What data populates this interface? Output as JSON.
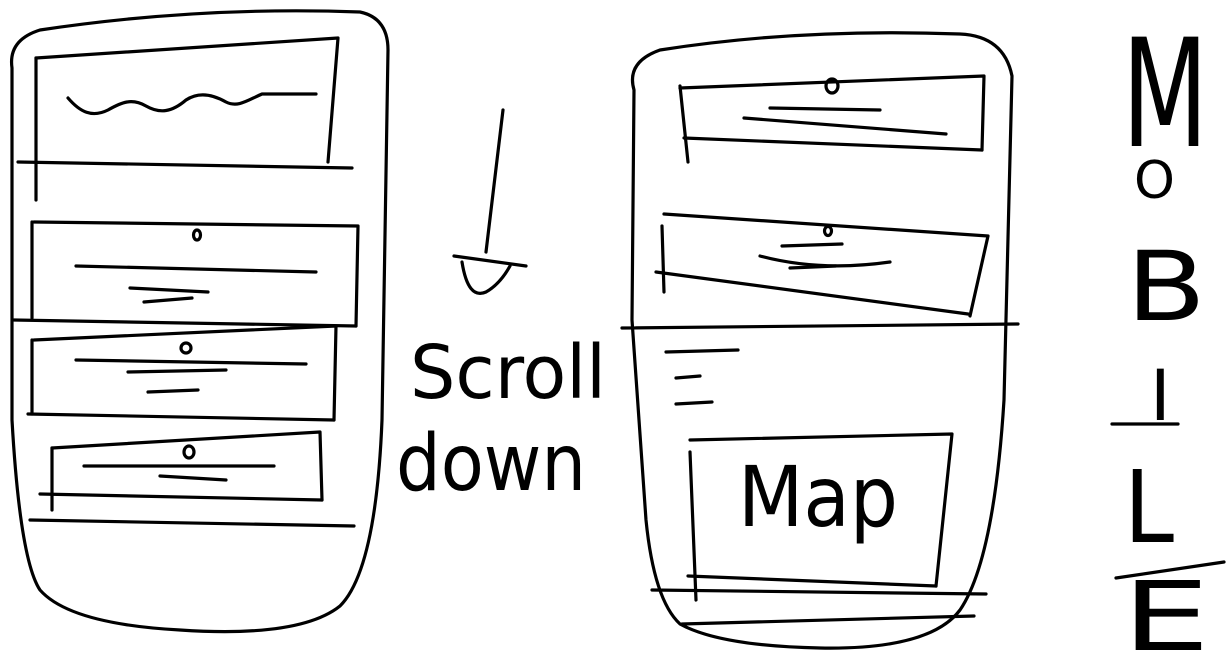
{
  "annotation": {
    "scroll_word": "Scroll",
    "down_word": "down"
  },
  "right_phone": {
    "map_label": "Map"
  },
  "side_title": {
    "letters": [
      "M",
      "O",
      "B",
      "I",
      "L",
      "E"
    ]
  }
}
